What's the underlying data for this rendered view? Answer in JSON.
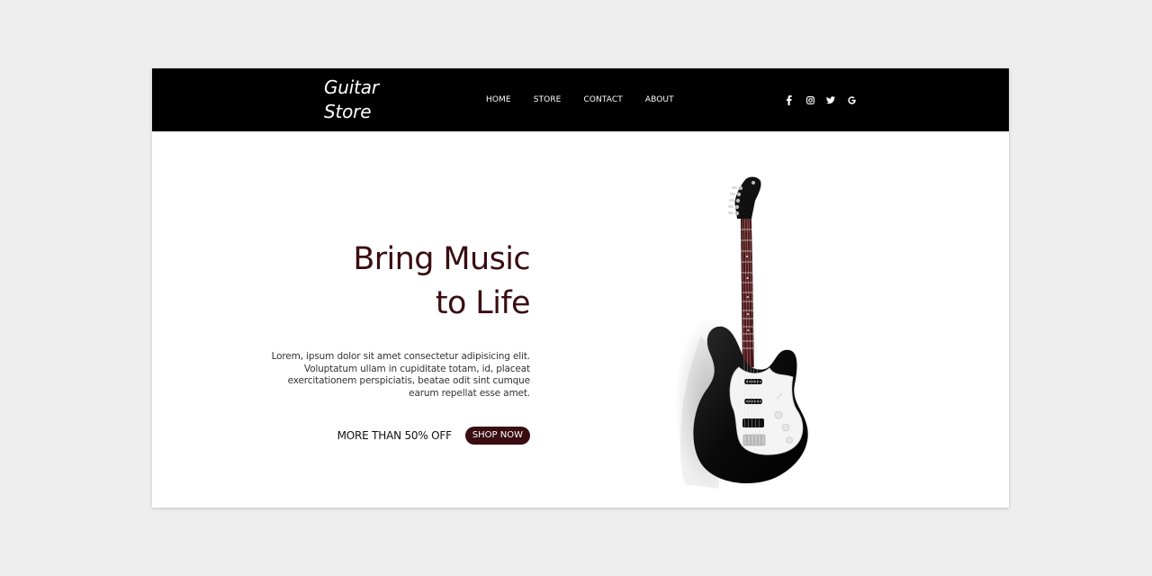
{
  "brand": {
    "line1": "Guitar",
    "line2": "Store"
  },
  "nav": {
    "items": [
      "HOME",
      "STORE",
      "CONTACT",
      "ABOUT"
    ]
  },
  "social": {
    "icons": [
      "facebook-icon",
      "instagram-icon",
      "twitter-icon",
      "google-icon"
    ]
  },
  "hero": {
    "title_line1": "Bring Music",
    "title_line2": "to Life",
    "description": "Lorem, ipsum dolor sit amet consectetur adipisicing elit. Voluptatum ullam in cupiditate totam, id, placeat exercitationem perspiciatis, beatae odit sint cumque earum repellat esse amet.",
    "promo_text": "MORE THAN 50% OFF",
    "cta_label": "SHOP NOW"
  },
  "colors": {
    "accent": "#3a0d12",
    "header_bg": "#000000",
    "page_bg": "#eeeeee"
  }
}
